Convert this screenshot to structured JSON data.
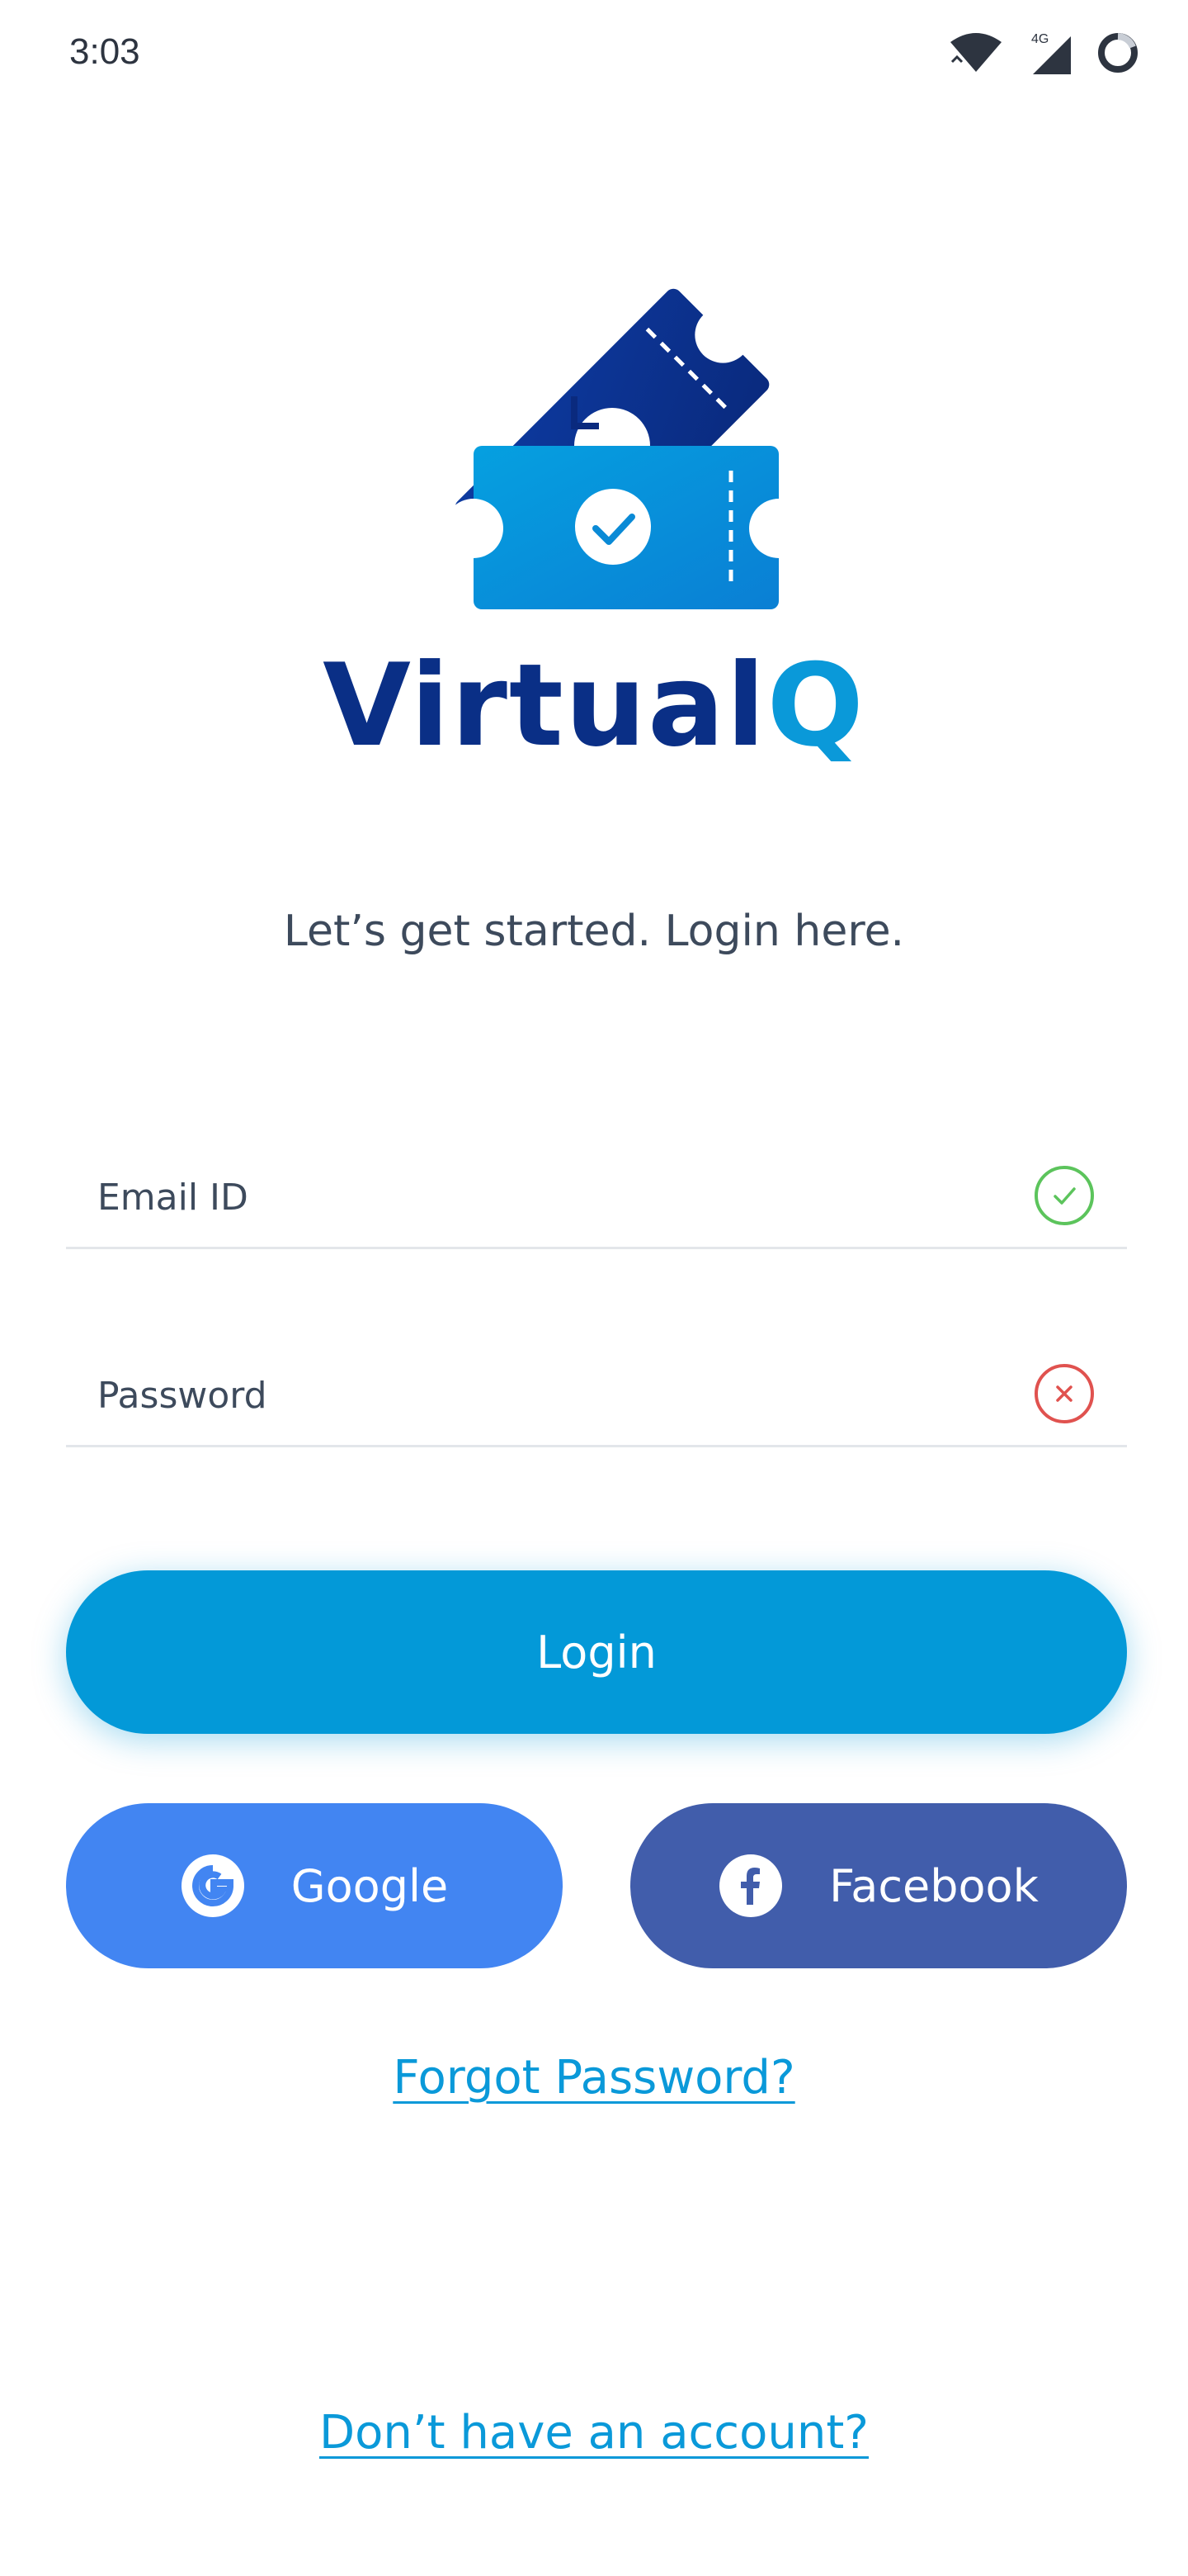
{
  "status_bar": {
    "time": "3:03",
    "network_label": "4G",
    "icons": [
      "wifi-icon",
      "cellular-signal-icon",
      "loading-ring-icon"
    ]
  },
  "brand": {
    "name_part1": "Virtual",
    "name_part2": "Q",
    "logo_icon": "ticket-logo-icon"
  },
  "tagline": "Let’s get started. Login here.",
  "form": {
    "email": {
      "placeholder": "Email ID",
      "value": "",
      "status": "valid",
      "status_icon": "check-circle-icon"
    },
    "password": {
      "placeholder": "Password",
      "value": "",
      "status": "invalid",
      "status_icon": "x-circle-icon"
    }
  },
  "buttons": {
    "login": "Login",
    "google": "Google",
    "facebook": "Facebook"
  },
  "links": {
    "forgot_password": "Forgot Password?",
    "signup": "Don’t have an account?"
  },
  "colors": {
    "primary": "#0399d8",
    "brand_dark": "#0a2f86",
    "google": "#4285f2",
    "facebook": "#415dab",
    "valid": "#5cc45c",
    "invalid": "#e0524f"
  }
}
